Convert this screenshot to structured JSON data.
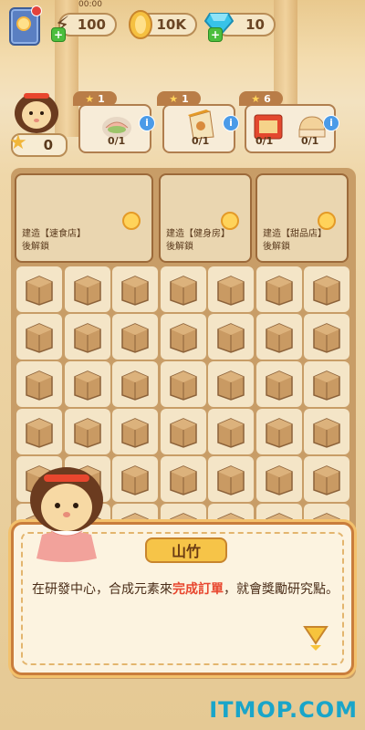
{
  "top_bar": {
    "timer": "00:00",
    "energy": "100",
    "coins": "10K",
    "gems": "10"
  },
  "player": {
    "stars": "0"
  },
  "orders": [
    {
      "reward": "1",
      "items": [
        {
          "icon": "sandwich-icon",
          "progress": "0/1"
        }
      ]
    },
    {
      "reward": "1",
      "items": [
        {
          "icon": "milk-carton-icon",
          "progress": "0/1"
        }
      ]
    },
    {
      "reward": "6",
      "items": [
        {
          "icon": "food-box-icon",
          "progress": "0/1"
        },
        {
          "icon": "bread-icon",
          "progress": "0/1"
        }
      ]
    }
  ],
  "locked_areas": [
    {
      "line1": "建造【速食店】",
      "line2": "後解鎖"
    },
    {
      "line1": "建造【健身房】",
      "line2": "後解鎖"
    },
    {
      "line1": "建造【甜品店】",
      "line2": "後解鎖"
    }
  ],
  "dialog": {
    "speaker": "山竹",
    "text_before": "在研發中心，合成元素來",
    "text_highlight": "完成訂單",
    "text_after": "，就會獎勵研究點。"
  },
  "watermark": "ITMOP.COM",
  "colors": {
    "accent": "#f6c448",
    "highlight": "#e8462e",
    "board": "#c89d67"
  }
}
